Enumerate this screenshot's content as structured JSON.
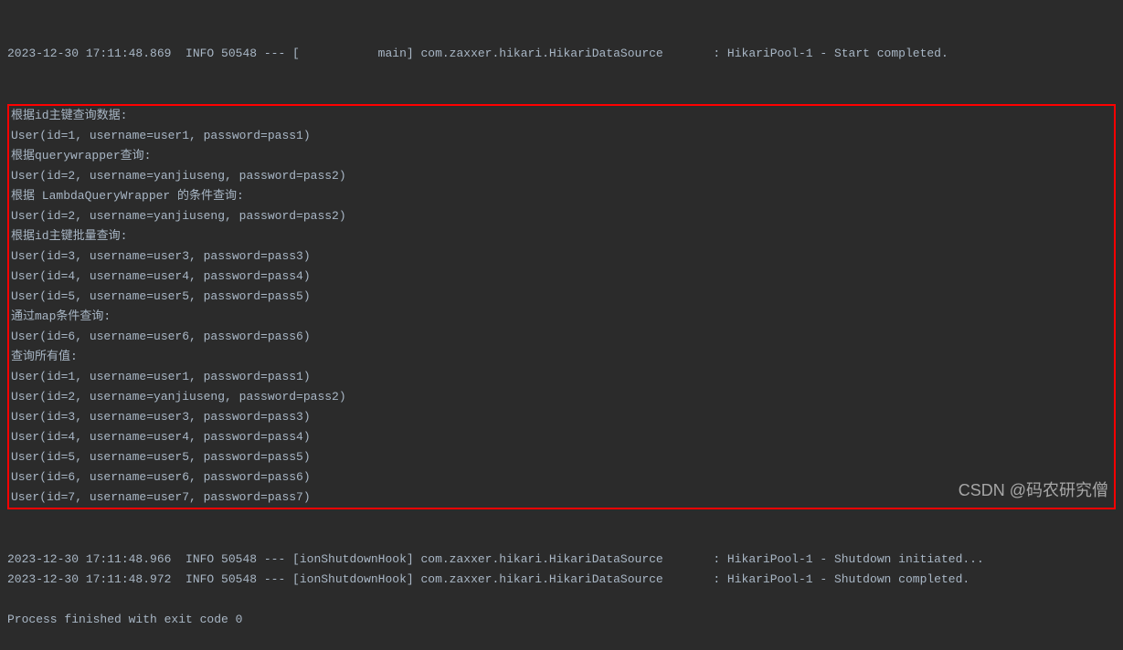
{
  "log_lines_before": [
    "2023-12-30 17:11:48.869  INFO 50548 --- [           main] com.zaxxer.hikari.HikariDataSource       : HikariPool-1 - Start completed."
  ],
  "highlighted_lines": [
    "根据id主键查询数据:",
    "User(id=1, username=user1, password=pass1)",
    "根据querywrapper查询:",
    "User(id=2, username=yanjiuseng, password=pass2)",
    "根据 LambdaQueryWrapper 的条件查询:",
    "User(id=2, username=yanjiuseng, password=pass2)",
    "根据id主键批量查询:",
    "User(id=3, username=user3, password=pass3)",
    "User(id=4, username=user4, password=pass4)",
    "User(id=5, username=user5, password=pass5)",
    "通过map条件查询:",
    "User(id=6, username=user6, password=pass6)",
    "查询所有值:",
    "User(id=1, username=user1, password=pass1)",
    "User(id=2, username=yanjiuseng, password=pass2)",
    "User(id=3, username=user3, password=pass3)",
    "User(id=4, username=user4, password=pass4)",
    "User(id=5, username=user5, password=pass5)",
    "User(id=6, username=user6, password=pass6)",
    "User(id=7, username=user7, password=pass7)"
  ],
  "log_lines_after": [
    "2023-12-30 17:11:48.966  INFO 50548 --- [ionShutdownHook] com.zaxxer.hikari.HikariDataSource       : HikariPool-1 - Shutdown initiated...",
    "2023-12-30 17:11:48.972  INFO 50548 --- [ionShutdownHook] com.zaxxer.hikari.HikariDataSource       : HikariPool-1 - Shutdown completed.",
    "",
    "Process finished with exit code 0"
  ],
  "watermark": "CSDN @码农研究僧"
}
